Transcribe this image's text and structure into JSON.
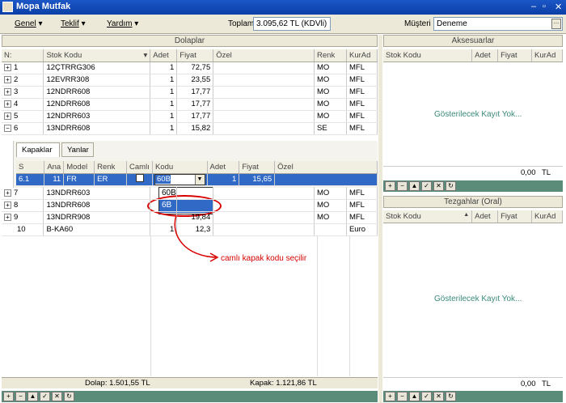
{
  "window": {
    "title": "Mopa Mutfak"
  },
  "menu": {
    "genel": "Genel",
    "teklif": "Teklif",
    "yardim": "Yardım",
    "toplam_label": "Toplam",
    "toplam_value": "3.095,62 TL (KDVli)",
    "musteri_label": "Müşteri",
    "musteri_value": "Deneme"
  },
  "dolaplar": {
    "title": "Dolaplar",
    "columns": [
      "N:",
      "Stok Kodu",
      "Adet",
      "Fiyat",
      "Özel",
      "Renk",
      "KurAd"
    ],
    "rows": [
      {
        "n": "1",
        "kod": "12ÇTRRG306",
        "adet": "1",
        "fiyat": "72,75",
        "ozel": "",
        "renk": "MO",
        "kur": "MFL"
      },
      {
        "n": "2",
        "kod": "12EVRR308",
        "adet": "1",
        "fiyat": "23,55",
        "ozel": "",
        "renk": "MO",
        "kur": "MFL"
      },
      {
        "n": "3",
        "kod": "12NDRR608",
        "adet": "1",
        "fiyat": "17,77",
        "ozel": "",
        "renk": "MO",
        "kur": "MFL"
      },
      {
        "n": "4",
        "kod": "12NDRR608",
        "adet": "1",
        "fiyat": "17,77",
        "ozel": "",
        "renk": "MO",
        "kur": "MFL"
      },
      {
        "n": "5",
        "kod": "12NDRR603",
        "adet": "1",
        "fiyat": "17,77",
        "ozel": "",
        "renk": "MO",
        "kur": "MFL"
      },
      {
        "n": "6",
        "kod": "13NDRR608",
        "adet": "1",
        "fiyat": "15,82",
        "ozel": "",
        "renk": "SE",
        "kur": "MFL"
      }
    ],
    "rows_after": [
      {
        "n": "7",
        "kod": "13NDRR603",
        "adet": "",
        "fiyat": "",
        "ozel": "",
        "renk": "MO",
        "kur": "MFL"
      },
      {
        "n": "8",
        "kod": "13NDRR608",
        "adet": "",
        "fiyat": "",
        "ozel": "",
        "renk": "MO",
        "kur": "MFL"
      },
      {
        "n": "9",
        "kod": "13NDRR908",
        "adet": "",
        "fiyat": "19,84",
        "ozel": "",
        "renk": "MO",
        "kur": "MFL"
      },
      {
        "n": "10",
        "kod": "B-KA60",
        "adet": "1",
        "fiyat": "12,3",
        "ozel": "",
        "renk": "",
        "kur": "Euro"
      }
    ],
    "tabs": [
      "Kapaklar",
      "Yanlar"
    ],
    "sub_columns": [
      "S",
      "Ana",
      "Model",
      "Renk",
      "Camlı",
      "Kodu",
      "Adet",
      "Fiyat",
      "Özel"
    ],
    "sub_row": {
      "s": "6.1",
      "ana": "11",
      "model": "FR",
      "renk": "ER",
      "kodu": "60B",
      "adet": "1",
      "fiyat": "15,65"
    },
    "dropdown_options": [
      "60B",
      "6B"
    ],
    "annotation": "camlı kapak kodu seçilir",
    "footer_dolap": "Dolap: 1.501,55 TL",
    "footer_kapak": "Kapak: 1.121,86 TL"
  },
  "aksesuarlar": {
    "title": "Aksesuarlar",
    "columns": [
      "Stok Kodu",
      "Adet",
      "Fiyat",
      "KurAd"
    ],
    "empty": "Gösterilecek Kayıt Yok...",
    "total": "0,00",
    "currency": "TL"
  },
  "tezgahlar": {
    "title": "Tezgahlar (Oral)",
    "columns": [
      "Stok Kodu",
      "Adet",
      "Fiyat",
      "KurAd"
    ],
    "empty": "Gösterilecek Kayıt Yok...",
    "total": "0,00",
    "currency": "TL"
  }
}
